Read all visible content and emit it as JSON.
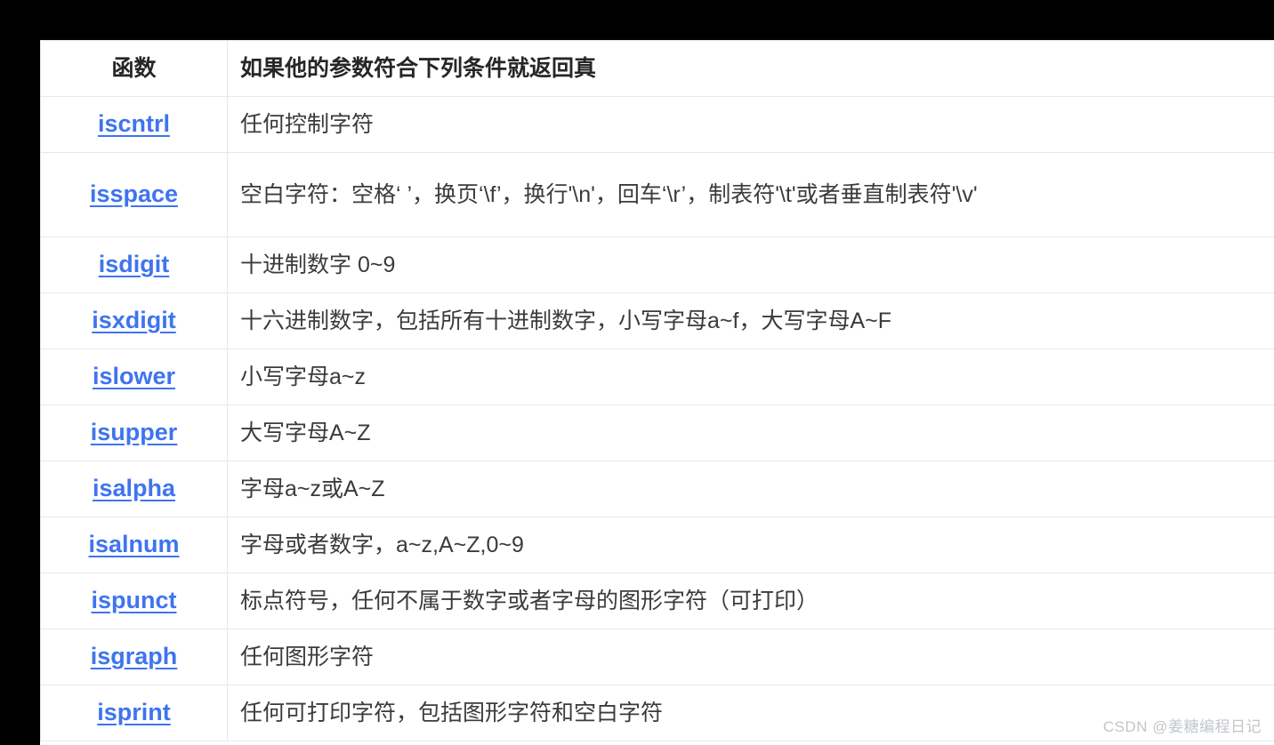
{
  "table": {
    "headers": {
      "function": "函数",
      "description": "如果他的参数符合下列条件就返回真"
    },
    "rows": [
      {
        "function": "iscntrl",
        "description": "任何控制字符"
      },
      {
        "function": "isspace",
        "description": "空白字符：空格‘ ’，换页‘\\f’，换行'\\n'，回车‘\\r’，制表符'\\t'或者垂直制表符'\\v'"
      },
      {
        "function": "isdigit",
        "description": "十进制数字 0~9"
      },
      {
        "function": "isxdigit",
        "description": "十六进制数字，包括所有十进制数字，小写字母a~f，大写字母A~F"
      },
      {
        "function": "islower",
        "description": "小写字母a~z"
      },
      {
        "function": "isupper",
        "description": "大写字母A~Z"
      },
      {
        "function": "isalpha",
        "description": "字母a~z或A~Z"
      },
      {
        "function": "isalnum",
        "description": "字母或者数字，a~z,A~Z,0~9"
      },
      {
        "function": "ispunct",
        "description": "标点符号，任何不属于数字或者字母的图形字符（可打印）"
      },
      {
        "function": "isgraph",
        "description": "任何图形字符"
      },
      {
        "function": "isprint",
        "description": "任何可打印字符，包括图形字符和空白字符"
      }
    ]
  },
  "watermark": {
    "text": "CSDN @姜糖编程日记"
  },
  "colors": {
    "link": "#3f74f0",
    "text": "#3b3b3b",
    "header_text": "#262626",
    "border": "#e3e8ee",
    "page_background": "#000000",
    "table_background": "#ffffff",
    "watermark": "#c2c6cb"
  }
}
